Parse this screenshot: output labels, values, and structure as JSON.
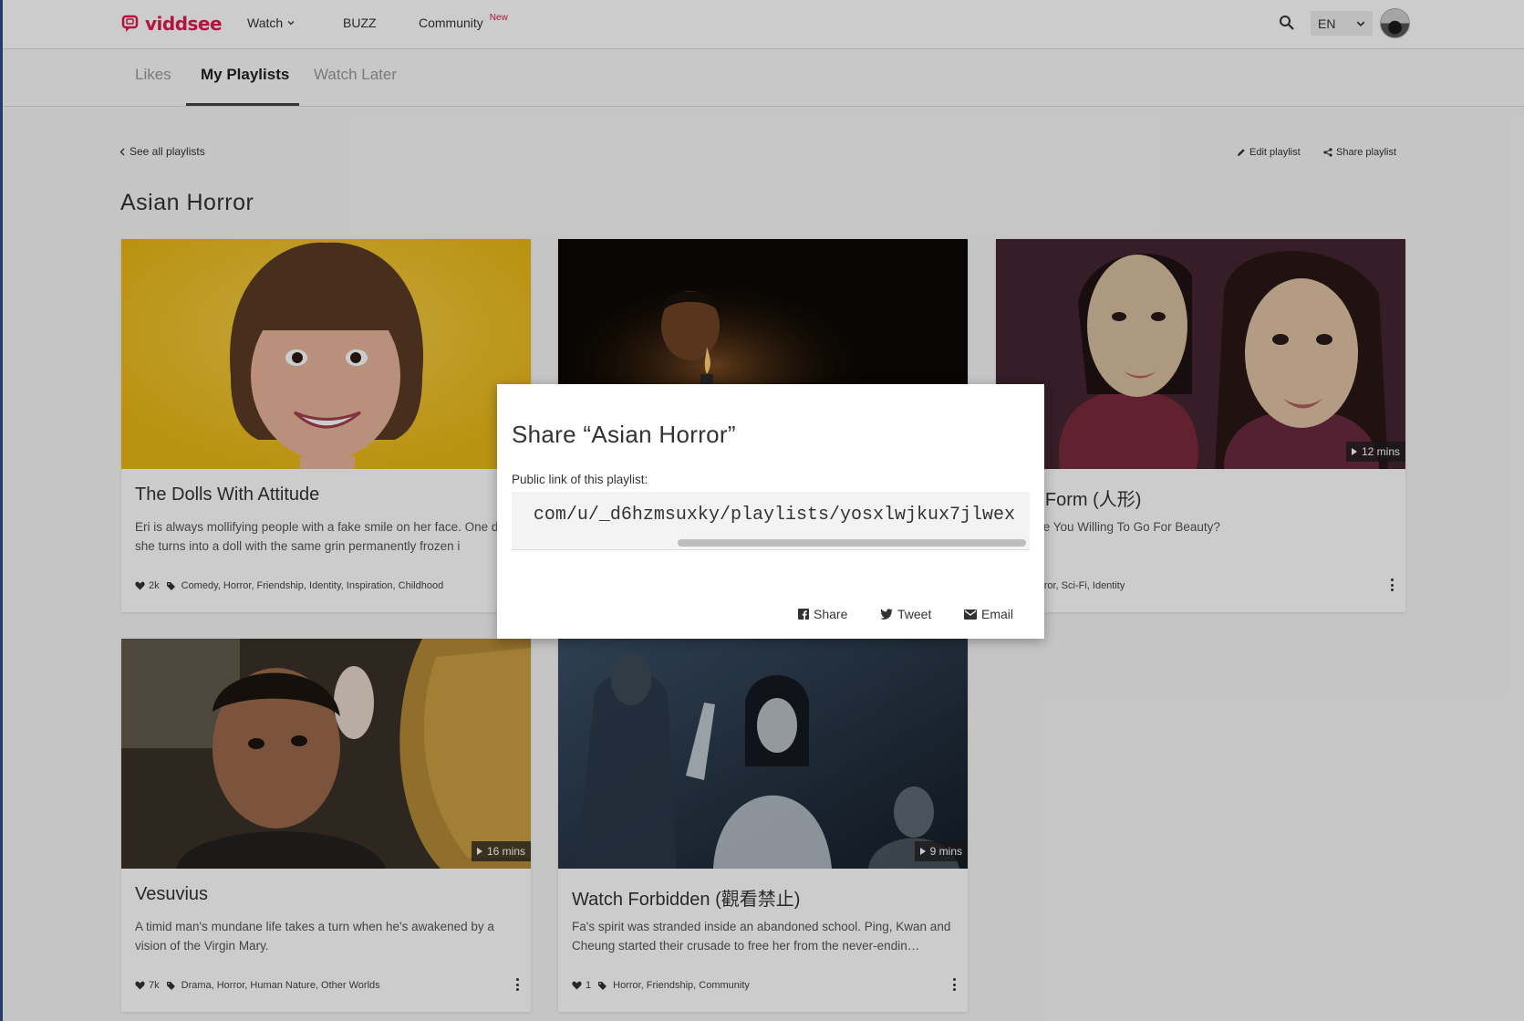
{
  "header": {
    "logo_text": "viddsee",
    "nav": {
      "watch": "Watch",
      "buzz": "BUZZ",
      "community": "Community",
      "community_badge": "New"
    },
    "language": "EN"
  },
  "tabs": {
    "likes": "Likes",
    "my_playlists": "My Playlists",
    "watch_later": "Watch Later"
  },
  "playlist": {
    "see_all": "See all playlists",
    "edit": "Edit playlist",
    "share": "Share playlist",
    "title": "Asian Horror"
  },
  "cards": [
    {
      "title": "The Dolls With Attitude",
      "desc": "Eri is always mollifying people with a fake smile on her face. One day, she turns into a doll with the same grin permanently frozen i",
      "likes": "2k",
      "tags": "Comedy, Horror, Friendship, Identity, Inspiration, Childhood",
      "duration": ""
    },
    {
      "title": "",
      "desc": "",
      "likes": "",
      "tags": "",
      "duration": ""
    },
    {
      "title": "nan Form (人形)",
      "desc": "Far Are You Willing To Go For Beauty?",
      "likes": "",
      "tags": "Horror, Sci-Fi, Identity",
      "duration": "12 mins"
    },
    {
      "title": "Vesuvius",
      "desc": "A timid man's mundane life takes a turn when he's awakened by a vision of the Virgin Mary.",
      "likes": "7k",
      "tags": "Drama, Horror, Human Nature, Other Worlds",
      "duration": "16 mins"
    },
    {
      "title": "Watch Forbidden (觀看禁止)",
      "desc": "Fa's spirit was stranded inside an abandoned school. Ping, Kwan and Cheung started their crusade to free her from the never-endin…",
      "likes": "1",
      "tags": "Horror, Friendship, Community",
      "duration": "9 mins"
    }
  ],
  "modal": {
    "title": "Share “Asian Horror”",
    "label": "Public link of this playlist:",
    "link": "com/u/_d6hzmsuxky/playlists/yosxlwjkux7jlwex",
    "share": "Share",
    "tweet": "Tweet",
    "email": "Email"
  },
  "colors": {
    "brand": "#e0184d",
    "overlay": "rgba(0,0,0,0.2)"
  }
}
